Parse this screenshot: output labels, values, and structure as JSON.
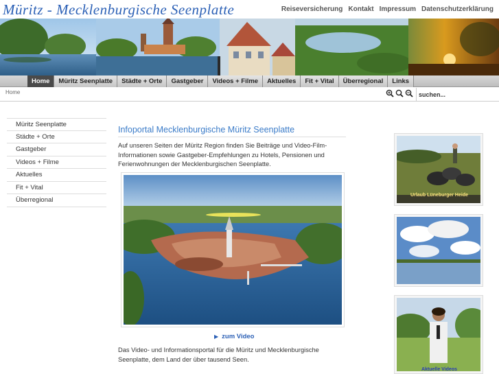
{
  "header": {
    "title": "Müritz - Mecklenburgische Seenplatte",
    "links": [
      "Reiseversicherung",
      "Kontakt",
      "Impressum",
      "Datenschutzerklärung"
    ]
  },
  "nav": {
    "items": [
      "Home",
      "Müritz Seenplatte",
      "Städte + Orte",
      "Gastgeber",
      "Videos + Filme",
      "Aktuelles",
      "Fit + Vital",
      "Überregional",
      "Links"
    ],
    "active_index": 0
  },
  "breadcrumb": "Home",
  "toolbar": {
    "zoom_icons": [
      "zoom-in-icon",
      "zoom-reset-icon",
      "zoom-out-icon"
    ]
  },
  "search": {
    "placeholder": "suchen..."
  },
  "sidebar": {
    "items": [
      "Müritz Seenplatte",
      "Städte + Orte",
      "Gastgeber",
      "Videos + Filme",
      "Aktuelles",
      "Fit + Vital",
      "Überregional"
    ]
  },
  "main": {
    "title": "Infoportal Mecklenburgische Müritz Seenplatte",
    "intro": "Auf unseren Seiten der Müritz Region finden Sie Beiträge und Video-Film-Informationen sowie Gastgeber-Empfehlungen zu Hotels, Pensionen und Ferienwohnungen der Mecklenburgischen Seenplatte.",
    "video_link": "zum Video",
    "bottom_text": "Das Video- und Informationsportal für die Müritz und Mecklenburgische Seenplatte, dem Land der über tausend Seen."
  },
  "thumbnails": [
    {
      "caption": "Urlaub Lüneburger Heide"
    },
    {
      "caption": ""
    },
    {
      "caption": "Aktuelle Videos"
    }
  ],
  "colors": {
    "title_blue": "#2a5fb5",
    "heading_blue": "#3a7bc8",
    "nav_active": "#4a4a4a"
  }
}
